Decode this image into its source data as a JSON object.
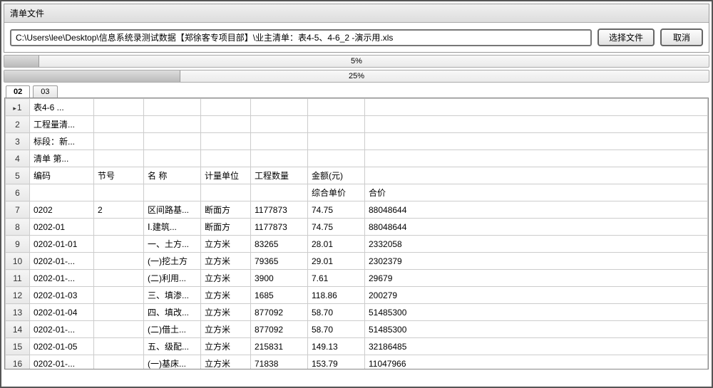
{
  "panel": {
    "title": "清单文件",
    "filepath": "C:\\Users\\lee\\Desktop\\信息系统录测试数据【郑徐客专项目部】\\业主清单：表4-5、4-6_2 -演示用.xls",
    "choose_label": "选择文件",
    "cancel_label": "取消"
  },
  "progress1": {
    "percent": 5,
    "label": "5%"
  },
  "progress2": {
    "percent": 25,
    "label": "25%"
  },
  "tabs": {
    "t1": "02",
    "t2": "03"
  },
  "grid": {
    "rows": [
      {
        "n": "1",
        "a": "表4-6   ...",
        "b": "",
        "c": "",
        "d": "",
        "e": "",
        "f": "",
        "g": ""
      },
      {
        "n": "2",
        "a": "工程量清...",
        "b": "",
        "c": "",
        "d": "",
        "e": "",
        "f": "",
        "g": ""
      },
      {
        "n": "3",
        "a": "标段：新...",
        "b": "",
        "c": "",
        "d": "",
        "e": "",
        "f": "",
        "g": ""
      },
      {
        "n": "4",
        "a": "清单  第...",
        "b": "",
        "c": "",
        "d": "",
        "e": "",
        "f": "",
        "g": ""
      },
      {
        "n": "5",
        "a": "编码",
        "b": "节号",
        "c": "名  称",
        "d": "计量单位",
        "e": "工程数量",
        "f": "金额(元)",
        "g": ""
      },
      {
        "n": "6",
        "a": "",
        "b": "",
        "c": "",
        "d": "",
        "e": "",
        "f": "综合单价",
        "g": "合价"
      },
      {
        "n": "7",
        "a": "0202",
        "b": "2",
        "c": "区间路基...",
        "d": "断面方",
        "e": "1177873",
        "f": "74.75",
        "g": "88048644"
      },
      {
        "n": "8",
        "a": "0202-01",
        "b": "",
        "c": "Ⅰ.建筑...",
        "d": "断面方",
        "e": "1177873",
        "f": "74.75",
        "g": "88048644"
      },
      {
        "n": "9",
        "a": "0202-01-01",
        "b": "",
        "c": "一、土方...",
        "d": "立方米",
        "e": "83265",
        "f": "28.01",
        "g": "2332058"
      },
      {
        "n": "10",
        "a": "0202-01-...",
        "b": "",
        "c": "(一)挖土方",
        "d": "立方米",
        "e": "79365",
        "f": "29.01",
        "g": "2302379"
      },
      {
        "n": "11",
        "a": "0202-01-...",
        "b": "",
        "c": "(二)利用...",
        "d": "立方米",
        "e": "3900",
        "f": "7.61",
        "g": "29679"
      },
      {
        "n": "12",
        "a": "0202-01-03",
        "b": "",
        "c": "三、填渗...",
        "d": "立方米",
        "e": "1685",
        "f": "118.86",
        "g": "200279"
      },
      {
        "n": "13",
        "a": "0202-01-04",
        "b": "",
        "c": "四、填改...",
        "d": "立方米",
        "e": "877092",
        "f": "58.70",
        "g": "51485300"
      },
      {
        "n": "14",
        "a": "0202-01-...",
        "b": "",
        "c": "(二)借土...",
        "d": "立方米",
        "e": "877092",
        "f": "58.70",
        "g": "51485300"
      },
      {
        "n": "15",
        "a": "0202-01-05",
        "b": "",
        "c": "五、级配...",
        "d": "立方米",
        "e": "215831",
        "f": "149.13",
        "g": "32186485"
      },
      {
        "n": "16",
        "a": "0202-01-...",
        "b": "",
        "c": "(一)基床...",
        "d": "立方米",
        "e": "71838",
        "f": "153.79",
        "g": "11047966"
      }
    ]
  }
}
